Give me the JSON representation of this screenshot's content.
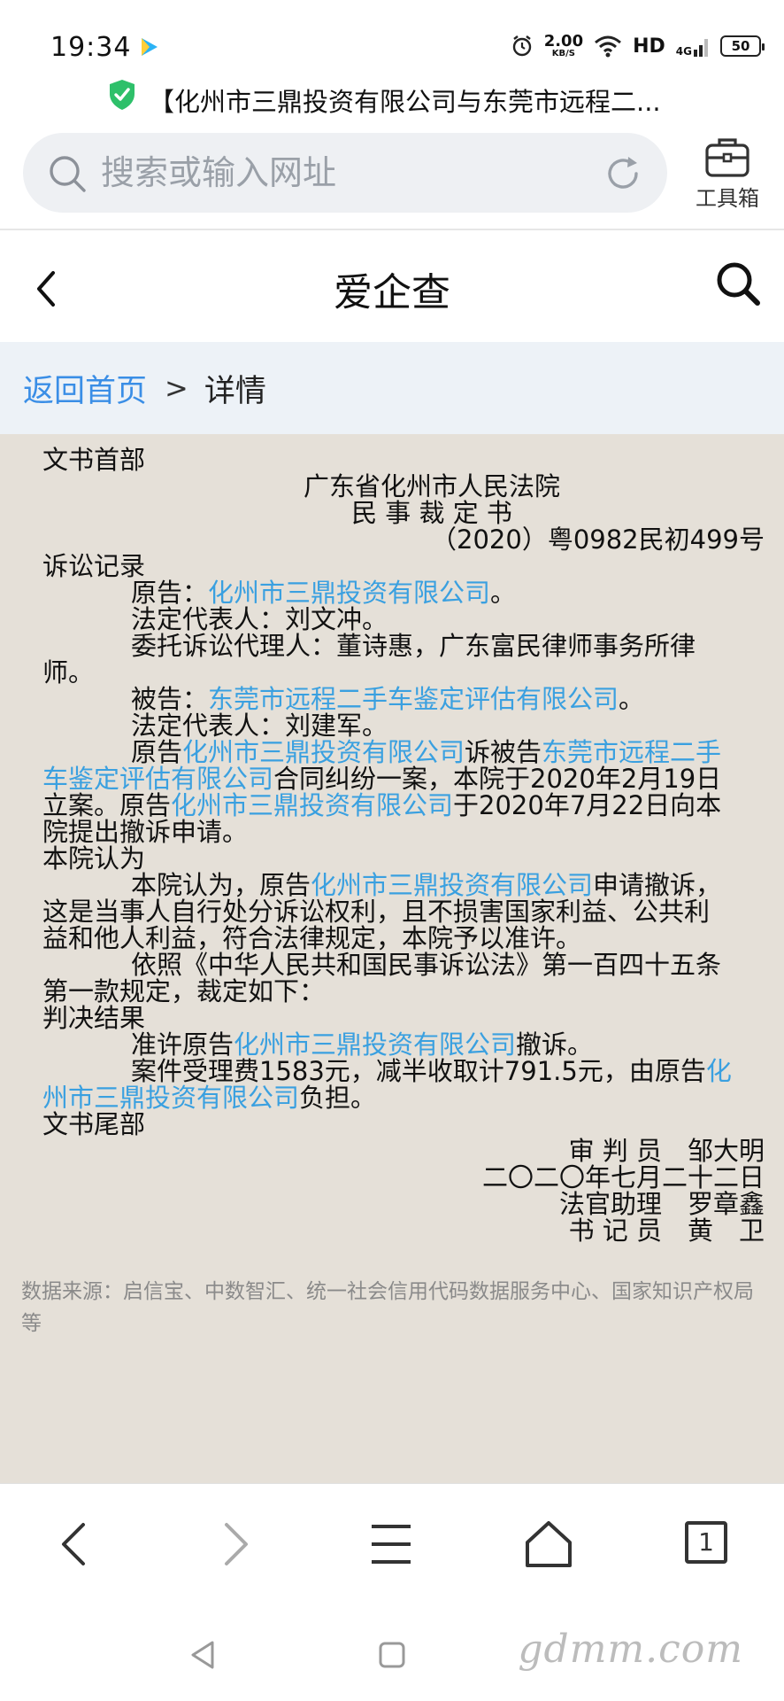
{
  "status_bar": {
    "time": "19:34",
    "net_speed_value": "2.00",
    "net_speed_unit": "KB/S",
    "hd": "HD",
    "network": "4G",
    "battery": "50"
  },
  "browser": {
    "page_title": "【化州市三鼎投资有限公司与东莞市远程二...",
    "search_placeholder": "搜索或输入网址",
    "toolbox_label": "工具箱",
    "tab_count": "1"
  },
  "app_header": {
    "title": "爱企查"
  },
  "breadcrumb": {
    "home": "返回首页",
    "separator": ">",
    "current": "详情"
  },
  "document": {
    "lines": [
      {
        "cls": "",
        "parts": [
          {
            "t": "文书首部"
          }
        ]
      },
      {
        "cls": "center",
        "parts": [
          {
            "t": "广东省化州市人民法院"
          }
        ]
      },
      {
        "cls": "center",
        "parts": [
          {
            "t": "民 事 裁 定 书"
          }
        ]
      },
      {
        "cls": "right",
        "parts": [
          {
            "t": "（2020）粤0982民初499号"
          }
        ]
      },
      {
        "cls": "",
        "parts": [
          {
            "t": "诉讼记录"
          }
        ]
      },
      {
        "cls": "indent",
        "parts": [
          {
            "t": "原告："
          },
          {
            "t": "化州市三鼎投资有限公司",
            "link": true
          },
          {
            "t": "。"
          }
        ]
      },
      {
        "cls": "indent",
        "parts": [
          {
            "t": "法定代表人：刘文冲。"
          }
        ]
      },
      {
        "cls": "indent",
        "parts": [
          {
            "t": "委托诉讼代理人：董诗惠，广东富民律师事务所律"
          }
        ]
      },
      {
        "cls": "",
        "parts": [
          {
            "t": "师。"
          }
        ]
      },
      {
        "cls": "indent",
        "parts": [
          {
            "t": "被告："
          },
          {
            "t": "东莞市远程二手车鉴定评估有限公司",
            "link": true
          },
          {
            "t": "。"
          }
        ]
      },
      {
        "cls": "indent",
        "parts": [
          {
            "t": "法定代表人：刘建军。"
          }
        ]
      },
      {
        "cls": "indent",
        "parts": [
          {
            "t": "原告"
          },
          {
            "t": "化州市三鼎投资有限公司",
            "link": true
          },
          {
            "t": "诉被告"
          },
          {
            "t": "东莞市远程二手",
            "link": true
          }
        ]
      },
      {
        "cls": "",
        "parts": [
          {
            "t": "车鉴定评估有限公司",
            "link": true
          },
          {
            "t": "合同纠纷一案，本院于2020年2月19日"
          }
        ]
      },
      {
        "cls": "",
        "parts": [
          {
            "t": "立案。原告"
          },
          {
            "t": "化州市三鼎投资有限公司",
            "link": true
          },
          {
            "t": "于2020年7月22日向本"
          }
        ]
      },
      {
        "cls": "",
        "parts": [
          {
            "t": "院提出撤诉申请。"
          }
        ]
      },
      {
        "cls": "",
        "parts": [
          {
            "t": "本院认为"
          }
        ]
      },
      {
        "cls": "indent",
        "parts": [
          {
            "t": "本院认为，原告"
          },
          {
            "t": "化州市三鼎投资有限公司",
            "link": true
          },
          {
            "t": "申请撤诉，"
          }
        ]
      },
      {
        "cls": "",
        "parts": [
          {
            "t": "这是当事人自行处分诉讼权利，且不损害国家利益、公共利"
          }
        ]
      },
      {
        "cls": "",
        "parts": [
          {
            "t": "益和他人利益，符合法律规定，本院予以准许。"
          }
        ]
      },
      {
        "cls": "indent",
        "parts": [
          {
            "t": "依照《中华人民共和国民事诉讼法》第一百四十五条"
          }
        ]
      },
      {
        "cls": "",
        "parts": [
          {
            "t": "第一款规定，裁定如下："
          }
        ]
      },
      {
        "cls": "",
        "parts": [
          {
            "t": "判决结果"
          }
        ]
      },
      {
        "cls": "indent",
        "parts": [
          {
            "t": "准许原告"
          },
          {
            "t": "化州市三鼎投资有限公司",
            "link": true
          },
          {
            "t": "撤诉。"
          }
        ]
      },
      {
        "cls": "indent",
        "parts": [
          {
            "t": "案件受理费1583元，减半收取计791.5元，由原告"
          },
          {
            "t": "化",
            "link": true
          }
        ]
      },
      {
        "cls": "",
        "parts": [
          {
            "t": "州市三鼎投资有限公司",
            "link": true
          },
          {
            "t": "负担。"
          }
        ]
      },
      {
        "cls": "",
        "parts": [
          {
            "t": "文书尾部"
          }
        ]
      },
      {
        "cls": "right",
        "parts": [
          {
            "t": "审 判 员　邹大明"
          }
        ]
      },
      {
        "cls": "right",
        "parts": [
          {
            "t": "二〇二〇年七月二十二日"
          }
        ]
      },
      {
        "cls": "right",
        "parts": [
          {
            "t": "法官助理　罗章鑫"
          }
        ]
      },
      {
        "cls": "right",
        "parts": [
          {
            "t": "书 记 员　黄　卫"
          }
        ]
      }
    ]
  },
  "source_note": "数据来源：启信宝、中数智汇、统一社会信用代码数据服务中心、国家知识产权局等",
  "watermark": "gdmm.com",
  "colors": {
    "link": "#3aa0e0",
    "breadcrumb_link": "#3a8ee6",
    "content_bg": "#e5e0d8",
    "breadcrumb_bg": "#edf2f7"
  }
}
